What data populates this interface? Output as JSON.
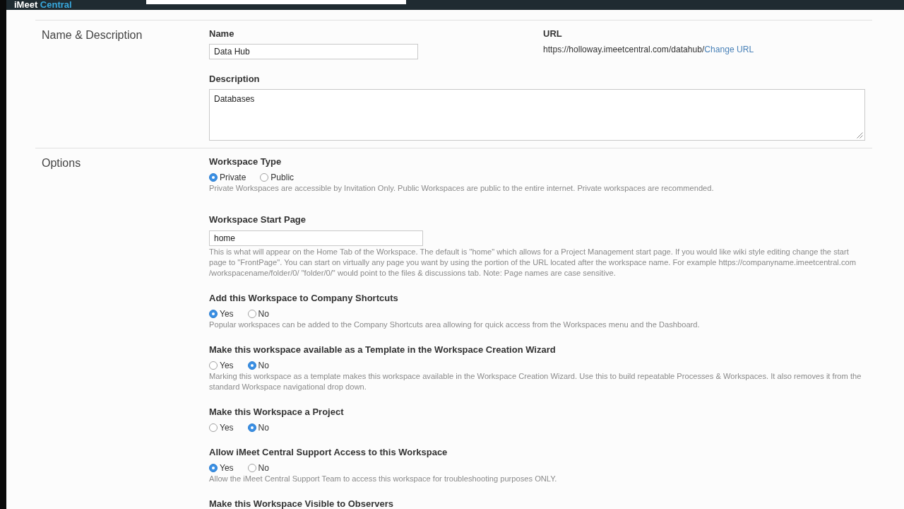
{
  "top_bar": {
    "logo": [
      "iMeet",
      "Central"
    ]
  },
  "sections": [
    {
      "kind": "details",
      "title": "Name & Description",
      "name": {
        "label": "Name",
        "value": "Data Hub"
      },
      "url": {
        "label": "URL",
        "address": "https://holloway.imeetcentral.com/datahub/",
        "link": "Change URL"
      },
      "description": {
        "label": "Description",
        "value": "Databases"
      }
    },
    {
      "kind": "options",
      "title": "Options",
      "items": [
        {
          "kind": "radio",
          "label": "Workspace Type",
          "choices": [
            {
              "label": "Private",
              "selected": true
            },
            {
              "label": "Public",
              "selected": false
            }
          ],
          "help": "Private Workspaces are accessible by Invitation Only. Public Workspaces are public to the entire internet. Private workspaces are recommended."
        },
        {
          "kind": "text",
          "label": "Workspace Start Page",
          "value": "home",
          "help": "This is what will appear on the Home Tab of the Workspace. The default is \"home\" which allows for a Project Management start page. If you would like wiki style editing change the start page to \"FrontPage\". You can start on virtually any page you want by using the portion of the URL located after the workspace name. For example https://companyname.imeetcentral.com /workspacename/folder/0/ \"folder/0/\" would point to the files & discussions tab. Note: Page names are case sensitive."
        },
        {
          "kind": "radio",
          "label": "Add this Workspace to Company Shortcuts",
          "choices": [
            {
              "label": "Yes",
              "selected": true
            },
            {
              "label": "No",
              "selected": false
            }
          ],
          "help": "Popular workspaces can be added to the Company Shortcuts area allowing for quick access from the Workspaces menu and the Dashboard."
        },
        {
          "kind": "radio",
          "label": "Make this workspace available as a Template in the Workspace Creation Wizard",
          "choices": [
            {
              "label": "Yes",
              "selected": false
            },
            {
              "label": "No",
              "selected": true
            }
          ],
          "help": "Marking this workspace as a template makes this workspace available in the Workspace Creation Wizard. Use this to build repeatable Processes & Workspaces. It also removes it from the standard Workspace navigational drop down."
        },
        {
          "kind": "radio",
          "label": "Make this Workspace a Project",
          "choices": [
            {
              "label": "Yes",
              "selected": false
            },
            {
              "label": "No",
              "selected": true
            }
          ]
        },
        {
          "kind": "radio",
          "label": "Allow iMeet Central Support Access to this Workspace",
          "choices": [
            {
              "label": "Yes",
              "selected": true
            },
            {
              "label": "No",
              "selected": false
            }
          ],
          "help": "Allow the iMeet Central Support Team to access this workspace for troubleshooting purposes ONLY."
        },
        {
          "kind": "radio",
          "label": "Make this Workspace Visible to Observers"
        }
      ]
    }
  ]
}
